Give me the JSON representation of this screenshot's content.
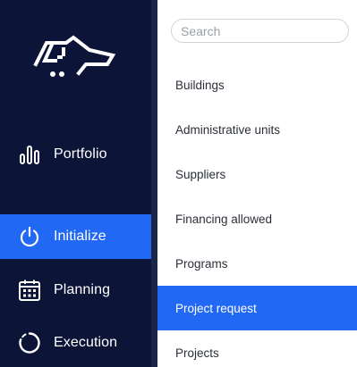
{
  "sidebar": {
    "logo_icon": "dog-head-logo",
    "items": [
      {
        "label": "Portfolio",
        "icon": "bar-chart-icon",
        "active": false
      },
      {
        "label": "Initialize",
        "icon": "power-icon",
        "active": true
      },
      {
        "label": "Planning",
        "icon": "calendar-icon",
        "active": false
      },
      {
        "label": "Execution",
        "icon": "progress-ring-icon",
        "active": false
      }
    ]
  },
  "panel": {
    "search": {
      "placeholder": "Search",
      "value": ""
    },
    "items": [
      {
        "label": "Buildings",
        "active": false
      },
      {
        "label": "Administrative units",
        "active": false
      },
      {
        "label": "Suppliers",
        "active": false
      },
      {
        "label": "Financing allowed",
        "active": false
      },
      {
        "label": "Programs",
        "active": false
      },
      {
        "label": "Project request",
        "active": true
      },
      {
        "label": "Projects",
        "active": false
      }
    ]
  },
  "colors": {
    "sidebar_bg": "#0c1538",
    "accent": "#2168f5",
    "text_dark": "#2b2f38"
  }
}
